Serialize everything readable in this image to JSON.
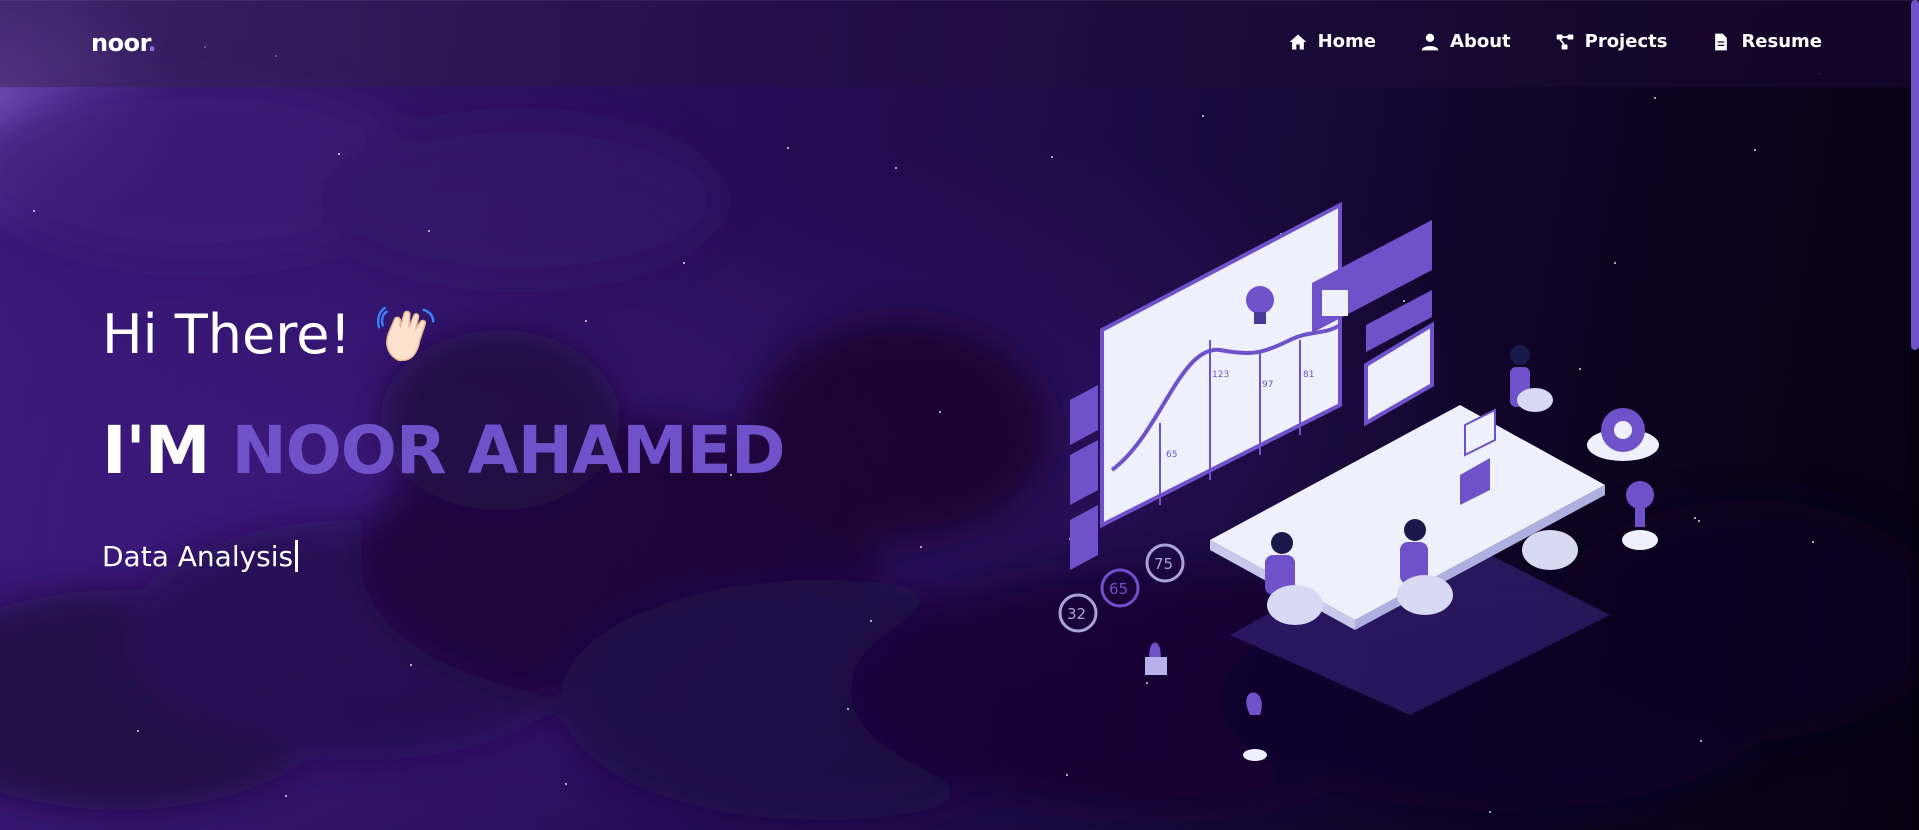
{
  "brand": {
    "text": "noor",
    "dot": "."
  },
  "nav": {
    "items": [
      {
        "label": "Home",
        "icon": "home-icon"
      },
      {
        "label": "About",
        "icon": "user-icon"
      },
      {
        "label": "Projects",
        "icon": "projects-icon"
      },
      {
        "label": "Resume",
        "icon": "document-icon"
      }
    ]
  },
  "hero": {
    "greeting": "Hi There!",
    "name_prefix": "I'M",
    "name": "NOOR AHAMED",
    "role": "Data Analysis",
    "wave_icon": "waving-hand-icon"
  },
  "illustration": {
    "chart_labels": [
      "123",
      "97",
      "81",
      "65"
    ],
    "gauge_values": [
      "32",
      "65",
      "75"
    ]
  },
  "colors": {
    "accent": "#6f52c9",
    "background_dark": "#0e0422",
    "background_purple": "#2a0f5e"
  }
}
